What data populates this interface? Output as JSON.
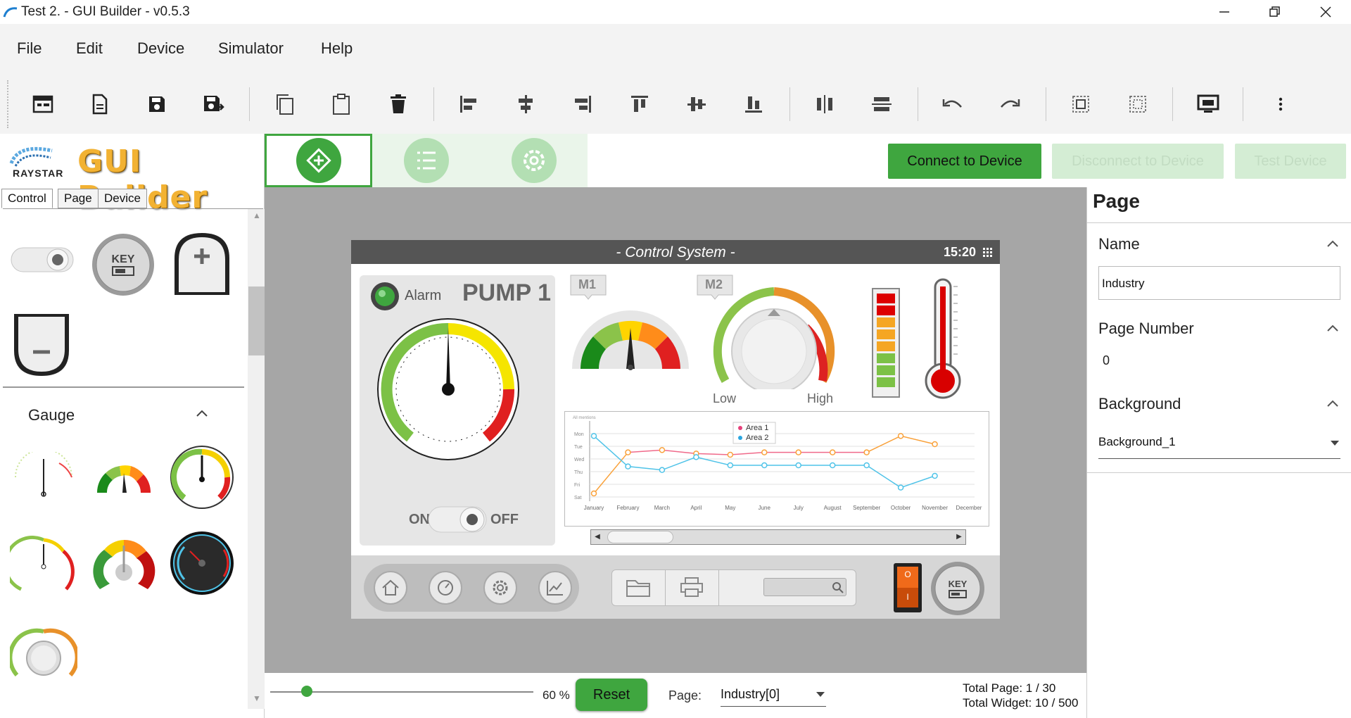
{
  "window": {
    "title": "Test 2. - GUI Builder - v0.5.3"
  },
  "menu": [
    "File",
    "Edit",
    "Device",
    "Simulator",
    "Help"
  ],
  "logo": {
    "brand": "RAYSTAR",
    "app": "GUI Builder"
  },
  "left_tabs": [
    "Control",
    "Page",
    "Device"
  ],
  "palette": {
    "section": "Gauge",
    "key_label": "KEY"
  },
  "header_buttons": {
    "connect": "Connect to Device",
    "disconnect": "Disconnect to Device",
    "test": "Test Device"
  },
  "preview": {
    "title": "- Control System -",
    "time": "15:20",
    "alarm": "Alarm",
    "pump": "PUMP 1",
    "on": "ON",
    "off": "OFF",
    "m1": "M1",
    "m2": "M2",
    "low": "Low",
    "high": "High",
    "key": "KEY",
    "switch_top": "O",
    "switch_bottom": "I",
    "chart": {
      "corner": "All mentions",
      "legend": [
        "Area 1",
        "Area 2"
      ]
    }
  },
  "chart_data": {
    "type": "line",
    "categories": [
      "January",
      "February",
      "March",
      "April",
      "May",
      "June",
      "July",
      "August",
      "September",
      "October",
      "November",
      "December"
    ],
    "y_labels": [
      "Mon",
      "Tue",
      "Wed",
      "Thu",
      "Fri",
      "Sat"
    ],
    "ylim": [
      0,
      6
    ],
    "series": [
      {
        "name": "Area 1",
        "color": "#f9a13a",
        "values": [
          0.3,
          3.8,
          4.0,
          3.7,
          3.6,
          3.8,
          3.8,
          3.8,
          3.8,
          5.2,
          4.5,
          null
        ]
      },
      {
        "name": "Area 2",
        "color": "#4fc3e8",
        "values": [
          5.2,
          2.6,
          2.3,
          3.4,
          2.7,
          2.7,
          2.7,
          2.7,
          2.7,
          0.8,
          1.8,
          null
        ]
      }
    ],
    "series_markers": [
      {
        "name": "Area 1",
        "color": "#f9a13a",
        "x": [
          0,
          1,
          2,
          3,
          4,
          5,
          6,
          7,
          8,
          9,
          10,
          11
        ],
        "y": [
          0.3,
          3.8,
          4.0,
          3.7,
          3.6,
          3.8,
          3.8,
          3.8,
          3.8,
          5.2,
          4.5,
          null
        ]
      },
      {
        "name": "Area 2",
        "color": "#4fc3e8",
        "x": [
          0,
          1,
          2,
          3,
          4,
          5,
          6,
          7,
          8,
          9,
          10,
          11
        ],
        "y": [
          5.2,
          2.6,
          2.3,
          3.4,
          2.7,
          2.7,
          2.7,
          2.7,
          2.7,
          0.8,
          1.8,
          null
        ]
      }
    ]
  },
  "right": {
    "header": "Page",
    "name_label": "Name",
    "name_value": "Industry",
    "page_number_label": "Page Number",
    "page_number_value": "0",
    "background_label": "Background",
    "background_value": "Background_1"
  },
  "bottom": {
    "zoom": "60 %",
    "zoom_level": 0.14,
    "reset": "Reset",
    "page_label": "Page:",
    "page_value": "Industry[0]",
    "total_page": "Total Page: 1 / 30",
    "total_widget": "Total Widget: 10 / 500"
  },
  "colors": {
    "accent": "#3fa63f",
    "accent_light": "#d4edd4",
    "canvas": "#a6a6a6"
  }
}
